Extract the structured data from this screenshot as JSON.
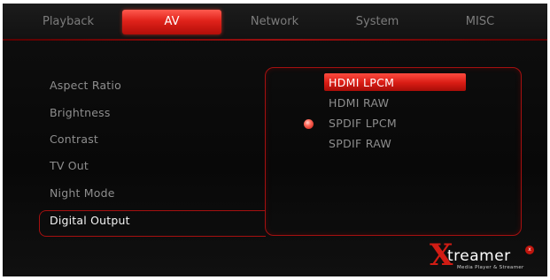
{
  "tabs": [
    {
      "label": "Playback",
      "active": false
    },
    {
      "label": "AV",
      "active": true
    },
    {
      "label": "Network",
      "active": false
    },
    {
      "label": "System",
      "active": false
    },
    {
      "label": "MISC",
      "active": false
    }
  ],
  "menu": {
    "items": [
      {
        "label": "Aspect Ratio"
      },
      {
        "label": "Brightness"
      },
      {
        "label": "Contrast"
      },
      {
        "label": "TV Out"
      },
      {
        "label": "Night Mode"
      },
      {
        "label": "Digital Output",
        "selected": true
      }
    ]
  },
  "options": {
    "items": [
      {
        "label": "HDMI LPCM",
        "highlighted": true
      },
      {
        "label": "HDMI RAW"
      },
      {
        "label": "SPDIF LPCM",
        "checked": true
      },
      {
        "label": "SPDIF RAW"
      }
    ]
  },
  "logo": {
    "brand": "treamer",
    "mark": "X",
    "tagline": "Media Player & Streamer"
  },
  "colors": {
    "accent": "#e0221a",
    "background": "#0c0c0c",
    "text_dim": "#8e8e8e",
    "text_bright": "#ffffff"
  }
}
